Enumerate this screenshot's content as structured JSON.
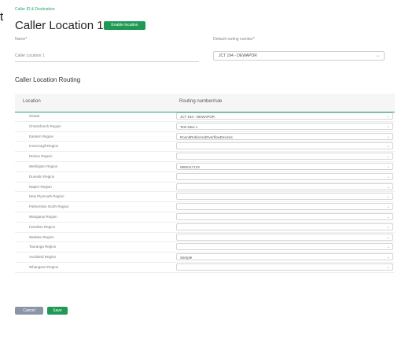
{
  "breadcrumb": "Caller ID & Destination",
  "fragment": "t",
  "title": "Caller Location 1",
  "badge": "Enable location",
  "fields": {
    "name_label": "Name*",
    "default_label": "Default routing number*",
    "caller_location_label": "Caller Location 1",
    "default_value": "JCT 194 - DEWAPOR"
  },
  "section_title": "Caller Location Routing",
  "table": {
    "col_location": "Location",
    "col_routing": "Routing number/rule"
  },
  "rows": [
    {
      "location": "Global",
      "routing": "JCT 194 - DEWAPOR"
    },
    {
      "location": "Christchurch Region",
      "routing": "Test New 1"
    },
    {
      "location": "Eastern Region",
      "routing": "RoundRobinAndOverflowDevices"
    },
    {
      "location": "Invercargill Region",
      "routing": ""
    },
    {
      "location": "Nelson Region",
      "routing": ""
    },
    {
      "location": "Wellington Region",
      "routing": "0800117123"
    },
    {
      "location": "Dunedin Region",
      "routing": ""
    },
    {
      "location": "Napier Region",
      "routing": ""
    },
    {
      "location": "New Plymouth Region",
      "routing": ""
    },
    {
      "location": "Palmerston North Region",
      "routing": ""
    },
    {
      "location": "Wanganui Region",
      "routing": ""
    },
    {
      "location": "Hamilton Region",
      "routing": ""
    },
    {
      "location": "Waikato Region",
      "routing": ""
    },
    {
      "location": "Tauranga Region",
      "routing": ""
    },
    {
      "location": "Auckland Region",
      "routing": "Sample"
    },
    {
      "location": "Whangarei Region",
      "routing": ""
    }
  ],
  "buttons": {
    "cancel": "Cancel",
    "save": "Save"
  },
  "icons": {
    "caret": "chevron-down-icon"
  },
  "colors": {
    "accent": "#1f9a55",
    "cancel": "#8a96a8"
  }
}
